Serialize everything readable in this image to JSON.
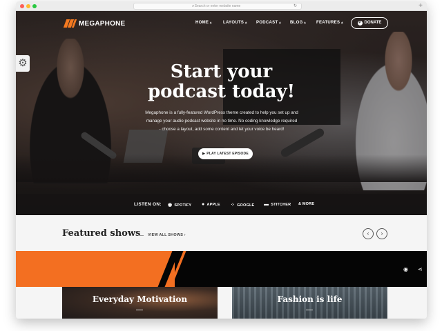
{
  "browser": {
    "url_text": "Search or enter website name",
    "new_tab": "+"
  },
  "nav": {
    "logo": "MEGAPHONE",
    "menu": [
      {
        "label": "HOME"
      },
      {
        "label": "LAYOUTS"
      },
      {
        "label": "PODCAST"
      },
      {
        "label": "BLOG"
      },
      {
        "label": "FEATURES"
      }
    ],
    "donate_label": "DONATE",
    "donate_icon": "paypal-icon"
  },
  "settings_icon": "gear-icon",
  "hero": {
    "title_line1": "Start your",
    "title_line2": "podcast today!",
    "text": "Megaphone is a fully-featured WordPress theme created to help you set up and manage your audio podcast website in no time. No coding knowledge required - choose a layout, add some content and let your voice be heard!",
    "play_label": "PLAY LATEST EPISODE",
    "play_icon": "play-icon"
  },
  "listen": {
    "label": "LISTEN ON:",
    "platforms": [
      {
        "label": "SPOTIFY",
        "icon": "spotify-icon",
        "glyph": "◉"
      },
      {
        "label": "APPLE",
        "icon": "apple-icon",
        "glyph": "●"
      },
      {
        "label": "GOOGLE",
        "icon": "google-podcasts-icon",
        "glyph": "⁘"
      },
      {
        "label": "STITCHER",
        "icon": "stitcher-icon",
        "glyph": "▬"
      },
      {
        "label": "& MORE",
        "icon": "",
        "glyph": ""
      }
    ]
  },
  "featured": {
    "title": "Featured shows",
    "view_all": "VIEW ALL SHOWS ›",
    "prev_icon": "chevron-left-icon",
    "next_icon": "chevron-right-icon"
  },
  "banner": {
    "rss_icon": "rss-icon",
    "share_icon": "share-icon"
  },
  "shows": [
    {
      "title": "Everyday Motivation"
    },
    {
      "title": "Fashion is life"
    }
  ],
  "colors": {
    "accent": "#f36f21",
    "dark": "#050505",
    "light_bg": "#f5f5f5"
  }
}
